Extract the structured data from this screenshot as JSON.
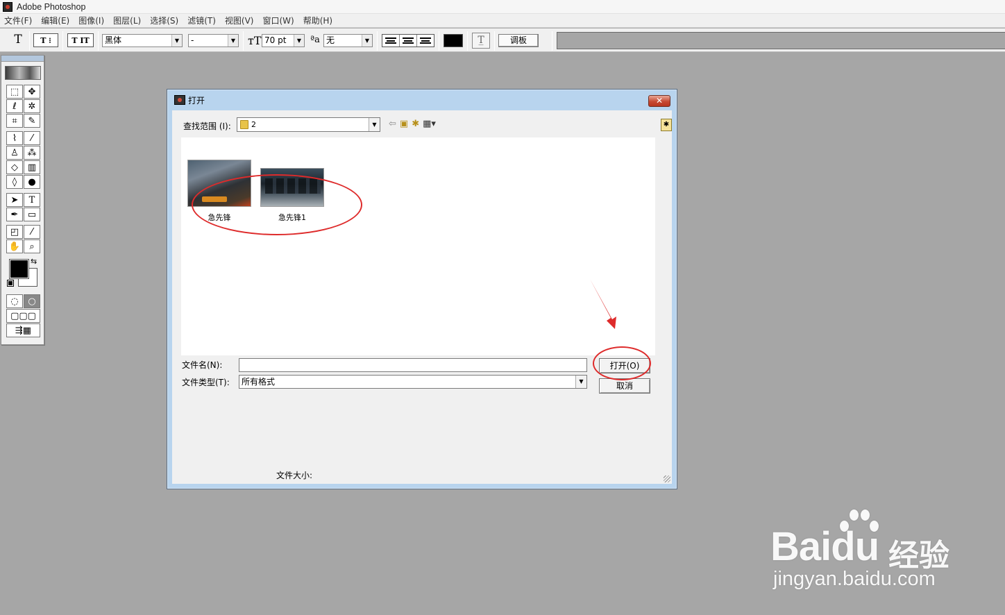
{
  "app": {
    "title": "Adobe Photoshop"
  },
  "menu": [
    "文件(F)",
    "编辑(E)",
    "图像(I)",
    "图层(L)",
    "选择(S)",
    "滤镜(T)",
    "视图(V)",
    "窗口(W)",
    "帮助(H)"
  ],
  "options": {
    "font_family": "黑体",
    "font_style": "-",
    "font_size": "70 pt",
    "antialias": "无",
    "palettes_label": "调板",
    "text_color": "#000000"
  },
  "dialog": {
    "title": "打开",
    "lookin_label": "查找范围 (I):",
    "lookin_value": "2",
    "files": [
      {
        "name": "急先锋"
      },
      {
        "name": "急先锋1"
      }
    ],
    "filename_label": "文件名(N):",
    "filename_value": "",
    "filetype_label": "文件类型(T):",
    "filetype_value": "所有格式",
    "open_label": "打开(O)",
    "cancel_label": "取消",
    "filesize_label": "文件大小:"
  },
  "annotation_color": "#de2b2b",
  "watermark": {
    "brand": "Bai",
    "brand2": "du",
    "cn": "经验",
    "url": "jingyan.baidu.com"
  }
}
